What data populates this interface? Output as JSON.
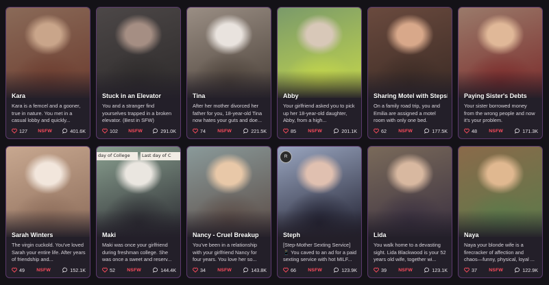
{
  "colors": {
    "background": "#141217",
    "card_border": "#5c3a6e",
    "nsfw": "#ff4d5e",
    "heart": "#ff4d5e"
  },
  "icons": {
    "likes": "heart-icon",
    "chats": "chat-bubble-icon"
  },
  "cards": [
    {
      "name": "Kara",
      "description": "Kara is a femcel and a gooner, true in nature. You met in a casual lobby and quickly...",
      "likes": "127",
      "tag": "NSFW",
      "chats": "401.6K",
      "palette": [
        "#8a6a58",
        "#c9a58a",
        "#6b3b2e"
      ]
    },
    {
      "name": "Stuck in an Elevator",
      "description": "You and a stranger find yourselves trapped in a broken elevator. (Best in SFW)",
      "likes": "102",
      "tag": "NSFW",
      "chats": "291.0K",
      "palette": [
        "#4c4747",
        "#a58e83",
        "#2d2a2a"
      ]
    },
    {
      "name": "Tina",
      "description": "After her mother divorced her father for you, 18-year-old Tina now hates your guts and doe...",
      "likes": "74",
      "tag": "NSFW",
      "chats": "221.5K",
      "palette": [
        "#9a8e84",
        "#e9e3de",
        "#4a4038"
      ]
    },
    {
      "name": "Abby",
      "description": "Your girlfriend asked you to pick up her 18-year-old daughter, Abby, from a high...",
      "likes": "85",
      "tag": "NSFW",
      "chats": "201.1K",
      "palette": [
        "#7a9a6a",
        "#d8c8b8",
        "#c7d94a"
      ]
    },
    {
      "name": "Sharing Motel with Stepsis",
      "description": "On a family road trip, you and Emilia are assigned a motel room with only one bed.",
      "likes": "62",
      "tag": "NSFW",
      "chats": "177.5K",
      "palette": [
        "#6a4a3e",
        "#d8a88a",
        "#3a2a24"
      ]
    },
    {
      "name": "Paying Sister's Debts",
      "description": "Your sister borrowed money from the wrong people and now it's your problem.",
      "likes": "48",
      "tag": "NSFW",
      "chats": "171.3K",
      "palette": [
        "#9a7a6a",
        "#e0b898",
        "#7a2a2a"
      ]
    },
    {
      "name": "Sarah Winters",
      "description": "The virgin cuckold. You've loved Sarah your entire life. After years of friendship and...",
      "likes": "49",
      "tag": "NSFW",
      "chats": "152.1K",
      "palette": [
        "#c8a890",
        "#f2e6dc",
        "#8a6a58"
      ]
    },
    {
      "name": "Maki",
      "description": "Maki was once your girlfriend during freshman college. She was once a sweet and reserv...",
      "likes": "52",
      "tag": "NSFW",
      "chats": "144.4K",
      "palette": [
        "#8aa090",
        "#eae6e0",
        "#2a2a30"
      ],
      "strips": [
        "day of College",
        "Last day of C"
      ]
    },
    {
      "name": "Nancy - Cruel Breakup",
      "description": "You've been in a relationship with your girlfriend Nancy for four years. You love her so...",
      "likes": "34",
      "tag": "NSFW",
      "chats": "143.8K",
      "palette": [
        "#8a9a9a",
        "#e8c8a8",
        "#5a4a44"
      ]
    },
    {
      "name": "Steph",
      "description": "[Step-Mother Sexting Service] 📱 You caved to an ad for a paid sexting service with hot MILF...",
      "likes": "66",
      "tag": "NSFW",
      "chats": "123.9K",
      "palette": [
        "#9aa6c0",
        "#e0c0b0",
        "#202030"
      ],
      "watermark": "R"
    },
    {
      "name": "Lida",
      "description": "You walk home to a devasting sight. Lida Blackwood is your 52 years old wife, together wi...",
      "likes": "39",
      "tag": "NSFW",
      "chats": "123.1K",
      "palette": [
        "#7a6a5a",
        "#d8b8a0",
        "#3a3040"
      ]
    },
    {
      "name": "Naya",
      "description": "Naya your blonde wife is a firecracker of affection and chaos—funny, physical, loyal ...",
      "likes": "37",
      "tag": "NSFW",
      "chats": "122.9K",
      "palette": [
        "#8a6a4a",
        "#e0b890",
        "#5a7a4a"
      ]
    }
  ]
}
